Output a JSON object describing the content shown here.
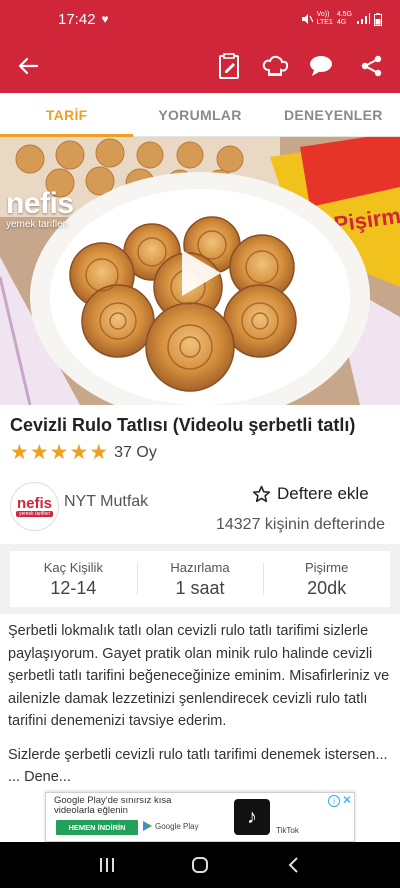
{
  "status_bar": {
    "time": "17:42",
    "network_top": "Vo))",
    "network_bottom": "LTE1",
    "network_type_top": "4.5G",
    "network_type_bottom": "4G"
  },
  "toolbar": {
    "icons": [
      "back-arrow-icon",
      "notebook-icon",
      "chef-hat-icon",
      "comment-icon",
      "share-icon"
    ]
  },
  "tabs": [
    {
      "label": "TARİF",
      "active": true
    },
    {
      "label": "YORUMLAR",
      "active": false
    },
    {
      "label": "DENEYENLER",
      "active": false
    }
  ],
  "video": {
    "logo_text": "nefis",
    "logo_subtext": "yemek tarifleri",
    "package_text": "Pişirm"
  },
  "recipe": {
    "title": "Cevizli Rulo Tatlısı (Videolu şerbetli tatlı)",
    "rating": 5,
    "votes": "37 Oy"
  },
  "author": {
    "logo_text": "nefis",
    "logo_subtext": "yemek tarifleri",
    "name": "NYT Mutfak"
  },
  "save": {
    "label": "Deftere ekle",
    "count_text": "14327 kişinin defterinde"
  },
  "info": [
    {
      "label": "Kaç Kişilik",
      "value": "12-14"
    },
    {
      "label": "Hazırlama",
      "value": "1 saat"
    },
    {
      "label": "Pişirme",
      "value": "20dk"
    }
  ],
  "description": {
    "paragraph1": "Şerbetli lokmalık tatlı olan cevizli rulo tatlı tarifimi sizlerle paylaşıyorum. Gayet pratik olan minik rulo halinde cevizli şerbetli tatlı tarifini beğeneceğinize eminim. Misafirleriniz ve ailenizle damak lezzetinizi şenlendirecek cevizli rulo tatlı tarifini denemenizi tavsiye ederim.",
    "paragraph2": "Sizlerde şerbetli cevizli rulo tatlı tarifimi denemek istersen... ... Dene..."
  },
  "ad": {
    "text": "Google Play'de sınırsız kısa videolarla eğlenin",
    "install_label": "HEMEN İNDİRİN",
    "store_label": "Google Play",
    "app_label": "TikTok"
  },
  "colors": {
    "brand_red": "#d0263a",
    "accent_orange": "#f0a020"
  }
}
